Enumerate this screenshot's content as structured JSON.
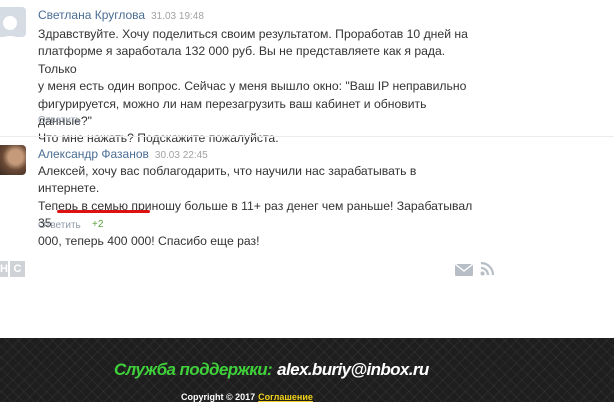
{
  "comments": [
    {
      "author": "Светлана Круглова",
      "date": "31.03 19:48",
      "lines": [
        "Здравствуйте. Хочу поделиться своим результатом. Проработав 10 дней на",
        "платформе я заработала 132 000 руб. Вы не представляете как я рада. Только",
        "у меня есть один вопрос. Сейчас у меня вышло окно: \"Ваш IP неправильно",
        "фигурируется, можно ли нам перезагрузить ваш кабинет и обновить данные?\"",
        "Что мне нажать? Подскажите пожалуйста."
      ],
      "reply_label": "Ответить"
    },
    {
      "author": "Александр Фазанов",
      "date": "30.03 22:45",
      "lines": [
        "Алексей, хочу вас поблагодарить, что научили нас зарабатывать в интернете.",
        "Теперь в семью приношу больше в 11+ раз денег чем раньше! Зарабатывал 35",
        "000, теперь 400 000! Спасибо еще раз!"
      ],
      "reply_label": "Ответить",
      "score": "+2"
    }
  ],
  "social_left": [
    "Н",
    "С"
  ],
  "icons": {
    "mail": "mail-icon",
    "rss": "rss-icon",
    "avatar_placeholder": "user-icon"
  },
  "footer": {
    "support_label": "Служба поддержки:",
    "support_email": "alex.buriy@inbox.ru",
    "copyright": "Copyright © 2017",
    "agreement_link": "Соглашение"
  },
  "colors": {
    "author": "#4a6d94",
    "underline": "#dd1111",
    "score": "#5aa13c",
    "support_label": "#3fd13a",
    "agreement": "#f2d21b"
  }
}
